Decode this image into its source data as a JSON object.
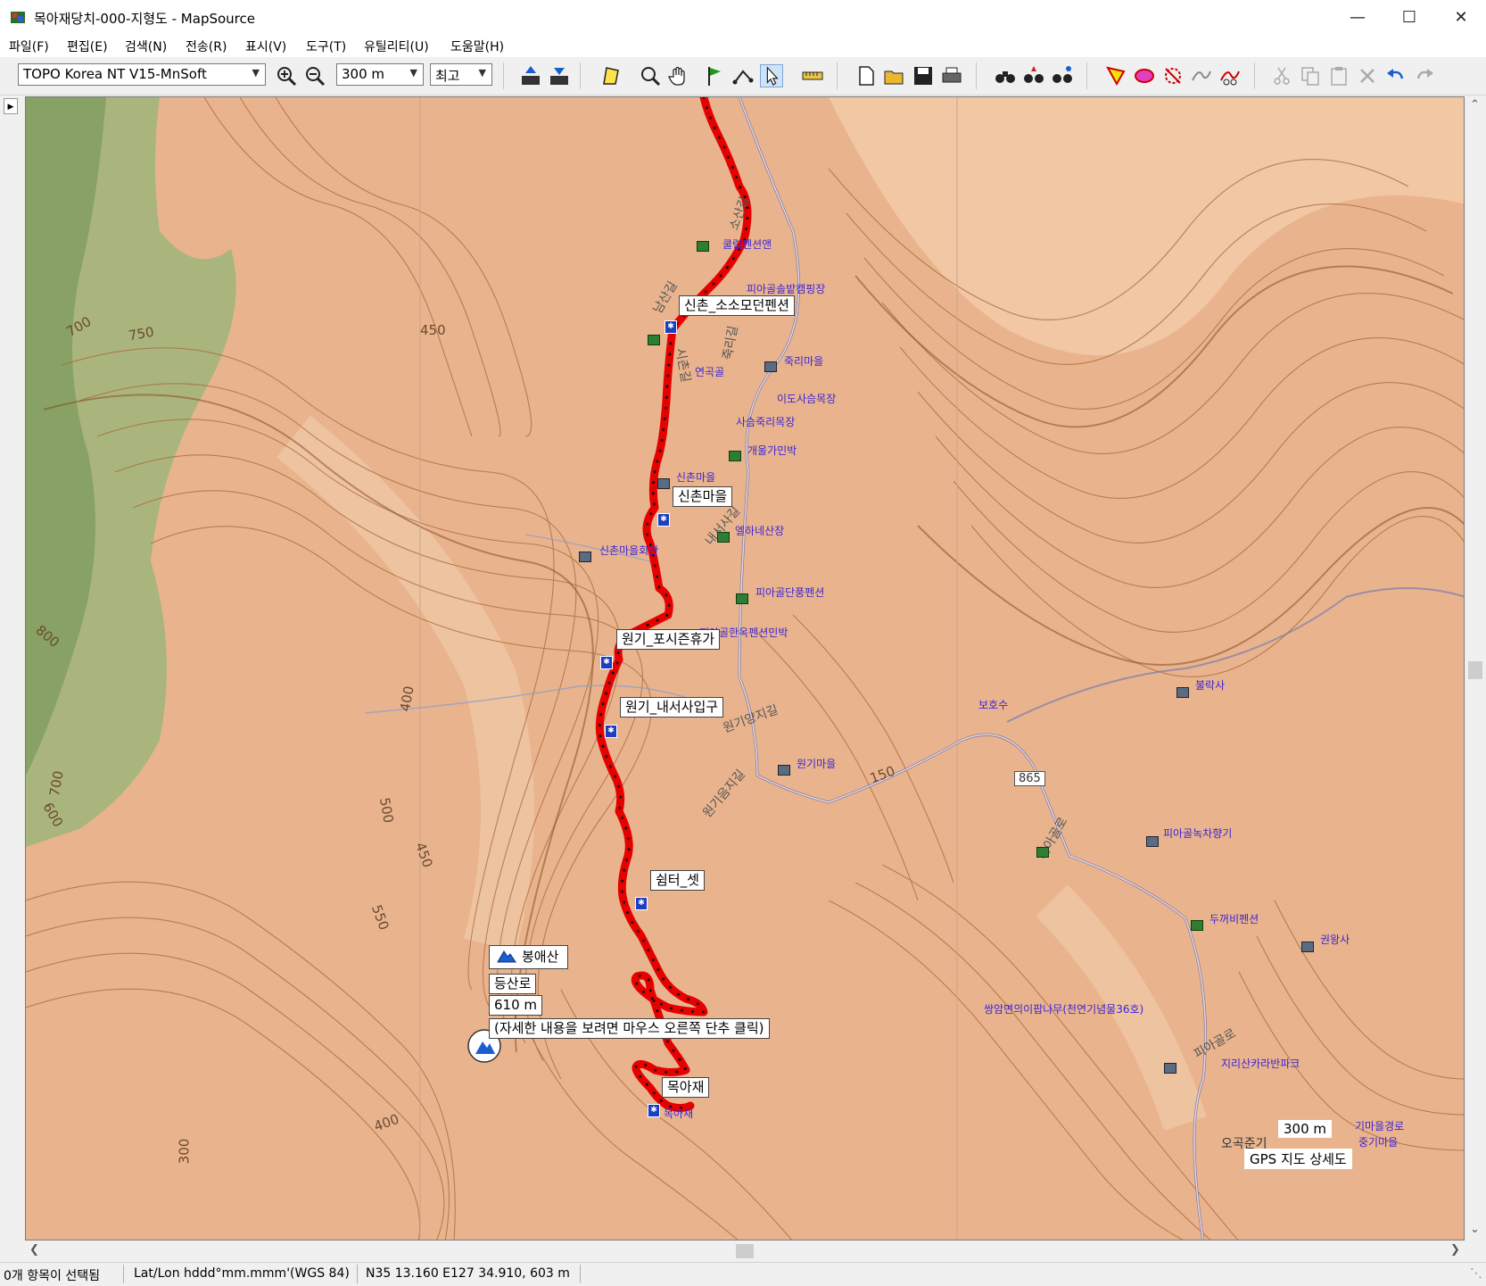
{
  "window": {
    "title": "목아재당치-000-지형도 - MapSource"
  },
  "menu": [
    {
      "label": "파일(F)"
    },
    {
      "label": "편집(E)"
    },
    {
      "label": "검색(N)"
    },
    {
      "label": "전송(R)"
    },
    {
      "label": "표시(V)"
    },
    {
      "label": "도구(T)"
    },
    {
      "label": "유틸리티(U)"
    },
    {
      "label": "도움말(H)"
    }
  ],
  "toolbar": {
    "map_product": "TOPO Korea NT V15-MnSoft",
    "zoom_level": "300 m",
    "detail_level": "최고"
  },
  "map": {
    "labels": {
      "sinchon_pension": "신촌_소소모던펜션",
      "sinchon_village": "신촌마을",
      "wongi_posizon": "원기_포시즌휴가",
      "wongi_entrance": "원기_내서사입구",
      "shelter3": "쉼터_셋",
      "mokajae": "목아재"
    },
    "tooltip": {
      "name": "봉애산",
      "type": "등산로",
      "elevation": "610 m",
      "hint": "(자세한 내용을 보려면 마우스 오른쪽 단추 클릭)"
    },
    "pois": {
      "p1": "쿨럽펜션앤",
      "p2": "피아골솔밭캠핑장",
      "p3": "죽리마을",
      "p4": "연곡골",
      "p5": "이도사슴목장",
      "p6": "사슴죽리목장",
      "p7": "개울가민박",
      "p8": "신촌마을",
      "p9": "엘하네산장",
      "p10": "신촌마을회관",
      "p11": "피아골단풍펜션",
      "p12": "피아골한옥펜션민박",
      "p13": "원기마을",
      "p14": "보호수",
      "p15": "불락사",
      "p16": "피아골녹차향기",
      "p17": "두꺼비펜션",
      "p18": "권왕사",
      "p19": "쌍암면의이팝나무(천연기념물36호)",
      "p20": "지리산카라반파크",
      "p21": "목아재",
      "p22": "기마을경로",
      "p23": "중기마을",
      "p24": "오곡준기"
    },
    "roads": {
      "r1": "내서사길",
      "r2": "원기양지길",
      "r3": "원기음지길",
      "r4": "피아골로",
      "r5": "피아골로",
      "r6": "남산길",
      "r7": "소산길",
      "r8": "시촌길",
      "r9": "죽리길",
      "road_number": "865"
    },
    "contours": {
      "c1": "700",
      "c2": "750",
      "c3": "450",
      "c4": "800",
      "c5": "400",
      "c6": "700",
      "c7": "600",
      "c8": "500",
      "c9": "450",
      "c10": "550",
      "c11": "400",
      "c12": "300",
      "c13": "150"
    },
    "scale": "300 m",
    "map_name": "GPS 지도 상세도"
  },
  "status": {
    "selection": "0개 항목이 선택됨",
    "format": "Lat/Lon hddd°mm.mmm'(WGS 84)",
    "position": "N35 13.160 E127 34.910, 603 m"
  },
  "colors": {
    "track": "#e60000",
    "terrain": "#e8b48e",
    "contour": "#a8683c",
    "forest": "#8fae6e",
    "poi_text": "#3b24d8"
  }
}
